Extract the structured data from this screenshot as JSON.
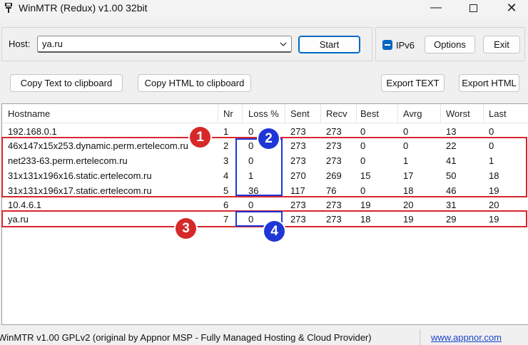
{
  "window": {
    "title": "WinMTR (Redux) v1.00 32bit",
    "min_glyph": "—",
    "close_glyph": "✕"
  },
  "host": {
    "label": "Host:",
    "value": "ya.ru"
  },
  "buttons": {
    "start": "Start",
    "options": "Options",
    "exit": "Exit",
    "copy_text": "Copy Text to clipboard",
    "copy_html": "Copy HTML to clipboard",
    "export_text": "Export TEXT",
    "export_html": "Export HTML"
  },
  "ipv6": {
    "label": "IPv6",
    "checked": true
  },
  "table": {
    "columns": [
      "Hostname",
      "Nr",
      "Loss %",
      "Sent",
      "Recv",
      "Best",
      "Avrg",
      "Worst",
      "Last"
    ],
    "rows": [
      [
        "192.168.0.1",
        "1",
        "0",
        "273",
        "273",
        "0",
        "0",
        "13",
        "0"
      ],
      [
        "46x147x15x253.dynamic.perm.ertelecom.ru",
        "2",
        "0",
        "273",
        "273",
        "0",
        "0",
        "22",
        "0"
      ],
      [
        "net233-63.perm.ertelecom.ru",
        "3",
        "0",
        "273",
        "273",
        "0",
        "1",
        "41",
        "1"
      ],
      [
        "31x131x196x16.static.ertelecom.ru",
        "4",
        "1",
        "270",
        "269",
        "15",
        "17",
        "50",
        "18"
      ],
      [
        "31x131x196x17.static.ertelecom.ru",
        "5",
        "36",
        "117",
        "76",
        "0",
        "18",
        "46",
        "19"
      ],
      [
        "10.4.6.1",
        "6",
        "0",
        "273",
        "273",
        "19",
        "20",
        "31",
        "20"
      ],
      [
        "ya.ru",
        "7",
        "0",
        "273",
        "273",
        "18",
        "19",
        "29",
        "19"
      ]
    ]
  },
  "annotations": {
    "badges": [
      "1",
      "2",
      "3",
      "4"
    ],
    "red_color": "#d8262d",
    "blue_color": "#1f37d6"
  },
  "status": {
    "text": "WinMTR v1.00 GPLv2 (original by Appnor MSP - Fully Managed Hosting & Cloud Provider)",
    "link": "www.appnor.com"
  },
  "icons": {
    "app": "mtr-app-icon",
    "dropdown": "chevron-down-icon"
  }
}
